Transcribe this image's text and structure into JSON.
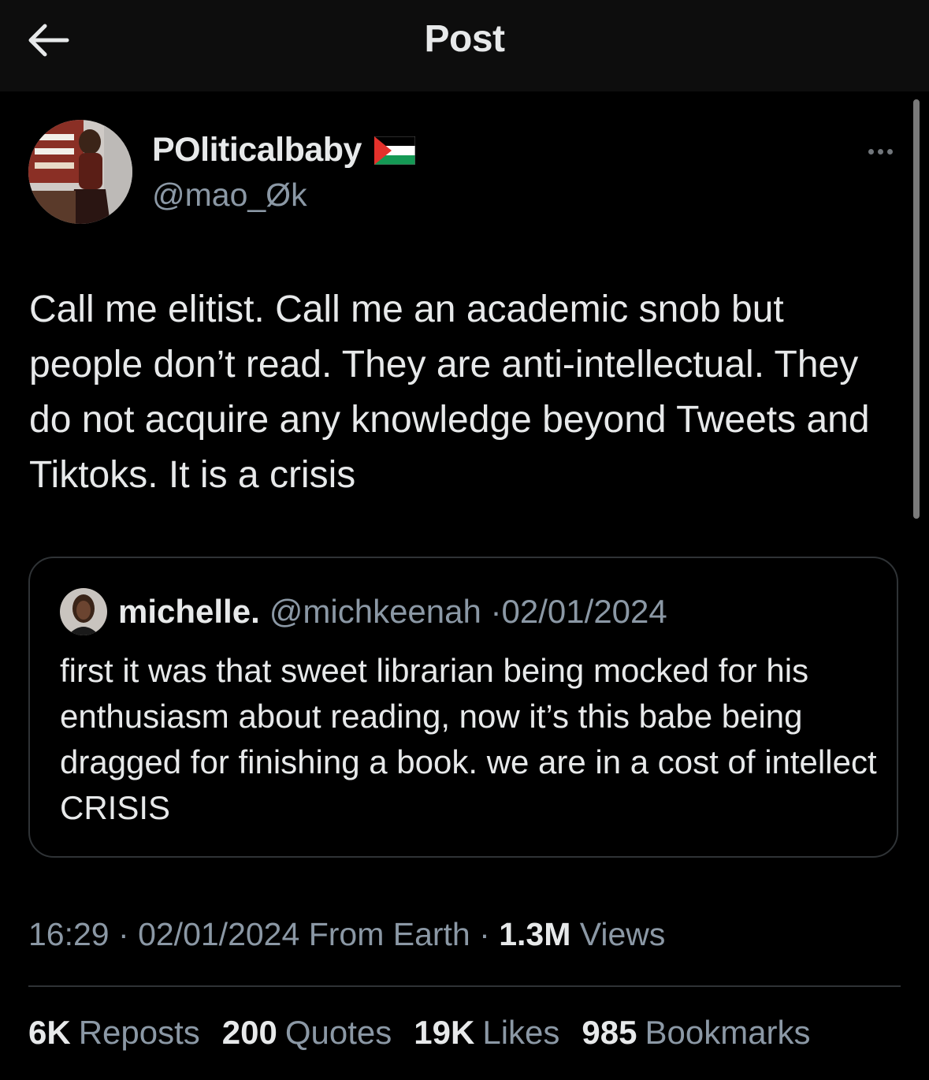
{
  "header": {
    "title": "Post",
    "back_icon": "arrow-left-icon"
  },
  "tweet": {
    "author_name": "POliticalbaby",
    "author_flag_icon": "palestine-flag-icon",
    "author_handle": "@mao_Øk",
    "text": "Call me elitist. Call me an academic snob but people don’t read. They are anti-intellectual. They do not acquire any knowledge beyond Tweets and Tiktoks. It is a crisis",
    "more_icon": "more-options-icon"
  },
  "quote": {
    "name": "michelle.",
    "handle": "@michkeenah",
    "separator": "·",
    "date": "02/01/2024",
    "text": "first it was that sweet librarian being mocked for his enthusiasm about reading, now it’s this babe being dragged for finishing a book. we are in a cost of intellect CRISIS"
  },
  "meta": {
    "time": "16:29",
    "sep1": "·",
    "date": "02/01/2024",
    "source": "From Earth",
    "sep2": "·",
    "views_count": "1.3M",
    "views_label": "Views"
  },
  "stats": [
    {
      "count": "6K",
      "label": "Reposts"
    },
    {
      "count": "200",
      "label": "Quotes"
    },
    {
      "count": "19K",
      "label": "Likes"
    },
    {
      "count": "985",
      "label": "Bookmarks"
    }
  ],
  "colors": {
    "background": "#000000",
    "header_background": "#0d0d0d",
    "text_primary": "#e7e9ea",
    "text_secondary": "#8b98a5",
    "border": "#2f3336"
  }
}
